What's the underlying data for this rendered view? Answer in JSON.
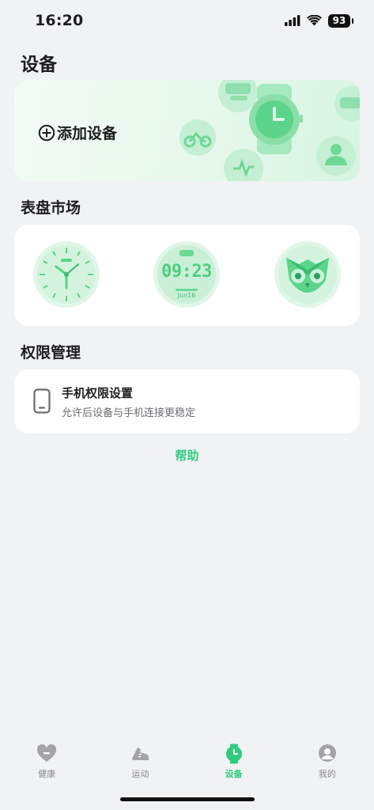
{
  "status": {
    "time": "16:20",
    "battery": "93"
  },
  "page": {
    "title": "设备"
  },
  "add_device": {
    "label": "添加设备"
  },
  "watch_faces": {
    "title": "表盘市场",
    "digital_time": "09:23",
    "digital_date": "Jun16"
  },
  "permissions": {
    "title": "权限管理",
    "item_title": "手机权限设置",
    "item_subtitle": "允许后设备与手机连接更稳定"
  },
  "help": {
    "label": "帮助"
  },
  "tabs": [
    {
      "label": "健康",
      "icon": "heart-icon"
    },
    {
      "label": "运动",
      "icon": "running-shoe-icon"
    },
    {
      "label": "设备",
      "icon": "watch-icon"
    },
    {
      "label": "我的",
      "icon": "profile-icon"
    }
  ],
  "colors": {
    "accent": "#2fcc80",
    "background": "#f1f2f4"
  }
}
